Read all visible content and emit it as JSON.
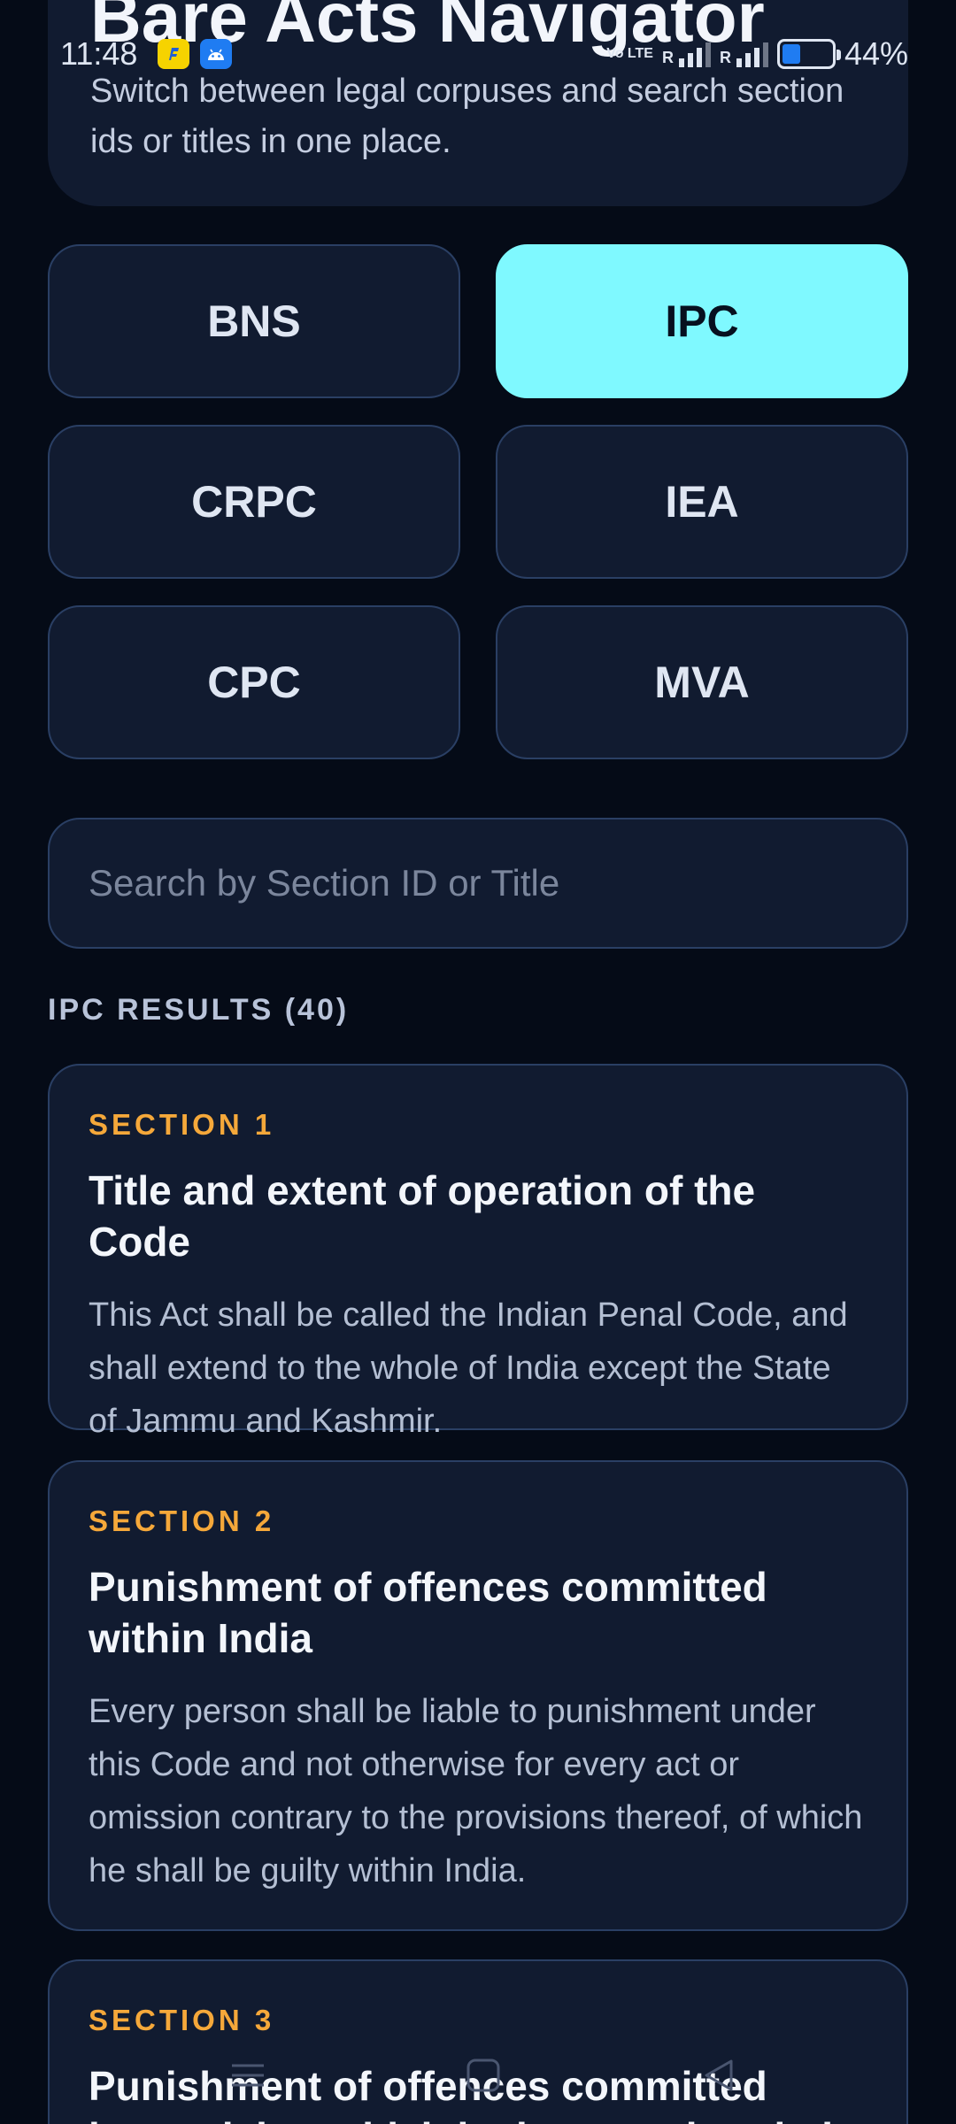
{
  "status_bar": {
    "time": "11:48",
    "volte": "Vo LTE",
    "signal_label": "R",
    "battery_percent": "44%",
    "battery_level": 0.44
  },
  "header": {
    "title": "Bare Acts Navigator",
    "subtitle": "Switch between legal corpuses and search section ids or titles in one place."
  },
  "corpus": {
    "selected": "IPC",
    "options": [
      "BNS",
      "IPC",
      "CRPC",
      "IEA",
      "CPC",
      "MVA"
    ]
  },
  "search": {
    "placeholder": "Search by Section ID or Title",
    "value": ""
  },
  "results": {
    "heading": "IPC RESULTS (40)",
    "items": [
      {
        "section": "SECTION 1",
        "title": "Title and extent of operation of the Code",
        "body": "This Act shall be called the Indian Penal Code, and shall extend to the whole of India except the State of Jammu and Kashmir."
      },
      {
        "section": "SECTION 2",
        "title": "Punishment of offences committed within India",
        "body": "Every person shall be liable to punishment under this Code and not otherwise for every act or omission contrary to the provisions thereof, of which he shall be guilty within India."
      },
      {
        "section": "SECTION 3",
        "title": "Punishment of offences committed beyond, but which by law may be tried within, India",
        "body": ""
      }
    ]
  },
  "colors": {
    "background": "#050b17",
    "card": "#111b30",
    "accent_active": "#7ff9ff",
    "section_label": "#f5a83a"
  }
}
